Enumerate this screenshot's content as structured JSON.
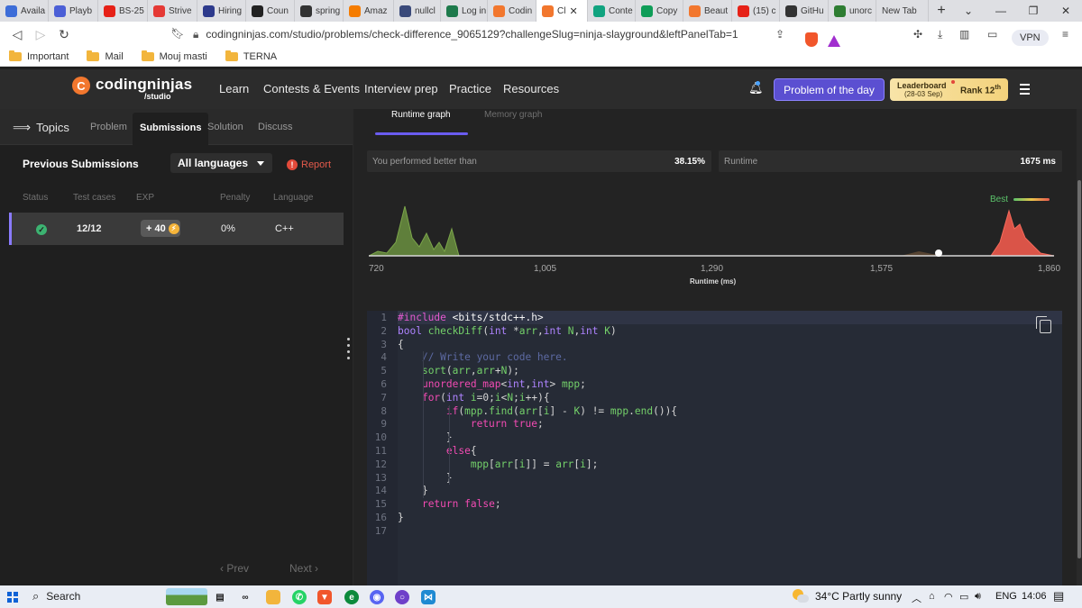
{
  "browser": {
    "tabs": [
      {
        "label": "Availa",
        "icon": "U",
        "color": "#3d6dd8"
      },
      {
        "label": "Playb",
        "icon": "ux",
        "color": "#4b5fd6"
      },
      {
        "label": "BS-25",
        "icon": "youtube",
        "color": "#e62117"
      },
      {
        "label": "Strive",
        "icon": "pdf",
        "color": "#e53935"
      },
      {
        "label": "Hiring",
        "icon": "un",
        "color": "#2d3a8c"
      },
      {
        "label": "Coun",
        "icon": "P",
        "color": "#222222"
      },
      {
        "label": "spring",
        "icon": "github",
        "color": "#333333"
      },
      {
        "label": "Amaz",
        "icon": "box",
        "color": "#f57c00"
      },
      {
        "label": "nullcl",
        "icon": "book",
        "color": "#3a4a7a"
      },
      {
        "label": "Log in",
        "icon": "leaf",
        "color": "#1e7a4c"
      },
      {
        "label": "Codin",
        "icon": "C",
        "color": "#f2772e"
      },
      {
        "label": "Cl",
        "icon": "C",
        "color": "#f2772e"
      },
      {
        "label": "Conte",
        "icon": "gpt",
        "color": "#10a37f"
      },
      {
        "label": "Copy",
        "icon": "+",
        "color": "#0f9d58"
      },
      {
        "label": "Beaut",
        "icon": "C",
        "color": "#f2772e"
      },
      {
        "label": "(15) c",
        "icon": "youtube",
        "color": "#e62117"
      },
      {
        "label": "GitHu",
        "icon": "github",
        "color": "#333333"
      },
      {
        "label": "unorc",
        "icon": "bing",
        "color": "#2e7d32"
      },
      {
        "label": "New Tab",
        "icon": "",
        "color": "#dedfe3"
      }
    ],
    "active_tab": 11,
    "url": "codingninjas.com/studio/problems/check-difference_9065129?challengeSlug=ninja-slayground&leftPanelTab=1",
    "vpn": "VPN",
    "bookmarks": [
      "Important",
      "Mail",
      "Mouj masti",
      "TERNA"
    ]
  },
  "app": {
    "logo": {
      "brand": "codingninjas",
      "sub": "/studio",
      "mark": "C"
    },
    "nav": [
      "Learn",
      "Contests & Events",
      "Interview prep",
      "Practice",
      "Resources"
    ],
    "potd": "Problem of the day",
    "leaderboard": {
      "title": "Leaderboard",
      "date": "(28-03 Sep)",
      "rank": "Rank",
      "rank_num": "12",
      "rank_suffix": "th"
    }
  },
  "left": {
    "topics": "Topics",
    "tabs": [
      "Problem",
      "Submissions",
      "Solution",
      "Discuss"
    ],
    "active_tab": "Submissions",
    "previous": "Previous Submissions",
    "language": "All languages",
    "report": "Report",
    "columns": [
      "Status",
      "Test cases",
      "EXP",
      "Penalty",
      "Language"
    ],
    "row": {
      "status": "accepted",
      "tests": "12/12",
      "exp": "+ 40",
      "penalty": "0%",
      "language": "C++"
    },
    "prev": "‹ Prev",
    "next": "Next ›"
  },
  "right": {
    "graph_tabs": [
      "Runtime graph",
      "Memory graph"
    ],
    "active_graph_tab": "Runtime graph",
    "better_label": "You performed better than",
    "better_value": "38.15%",
    "runtime_label": "Runtime",
    "runtime_value": "1675 ms",
    "best": "Best",
    "xticks": [
      "720",
      "1,005",
      "1,290",
      "1,575",
      "1,860"
    ],
    "xlabel": "Runtime (ms)",
    "your_runtime": 1675
  },
  "code": {
    "lines": [
      "#include <bits/stdc++.h>",
      "bool checkDiff(int *arr,int N,int K)",
      "{",
      "    // Write your code here.",
      "    sort(arr,arr+N);",
      "    unordered_map<int,int> mpp;",
      "    for(int i=0;i<N;i++){",
      "        if(mpp.find(arr[i] - K) != mpp.end()){",
      "            return true;",
      "        }",
      "        else{",
      "            mpp[arr[i]] = arr[i];",
      "        }",
      "    }",
      "    return false;",
      "}",
      ""
    ]
  },
  "taskbar": {
    "search": "Search",
    "weather": "34°C  Partly sunny",
    "lang": "ENG",
    "time": "14:06"
  }
}
